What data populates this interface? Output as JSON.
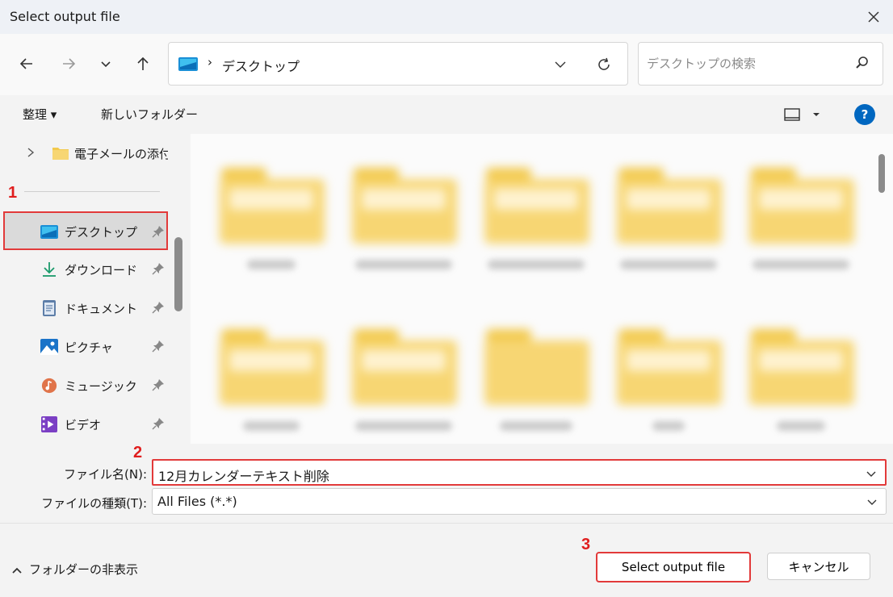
{
  "window": {
    "title": "Select output file"
  },
  "address": {
    "separator": "›",
    "path": "デスクトップ"
  },
  "search": {
    "placeholder": "デスクトップの検索"
  },
  "commands": {
    "organize": "整理 ▾",
    "new_folder": "新しいフォルダー"
  },
  "sidebar": {
    "top_item": "電子メールの添付",
    "items": [
      {
        "label": "デスクトップ",
        "icon": "desktop-icon",
        "selected": true
      },
      {
        "label": "ダウンロード",
        "icon": "download-icon"
      },
      {
        "label": "ドキュメント",
        "icon": "document-icon"
      },
      {
        "label": "ピクチャ",
        "icon": "pictures-icon"
      },
      {
        "label": "ミュージック",
        "icon": "music-icon"
      },
      {
        "label": "ビデオ",
        "icon": "video-icon"
      }
    ]
  },
  "annotations": {
    "step1": "1",
    "step2": "2",
    "step3": "3"
  },
  "file": {
    "name_label": "ファイル名(N):",
    "name_value": "12月カレンダーテキスト削除",
    "type_label": "ファイルの種類(T):",
    "type_value": "All Files (*.*)"
  },
  "footer": {
    "hide_folders": "フォルダーの非表示",
    "save_button": "Select output file",
    "cancel_button": "キャンセル"
  },
  "colors": {
    "accent": "#0067c0",
    "annotation": "#e23a3a",
    "folder": "#f7d673"
  }
}
